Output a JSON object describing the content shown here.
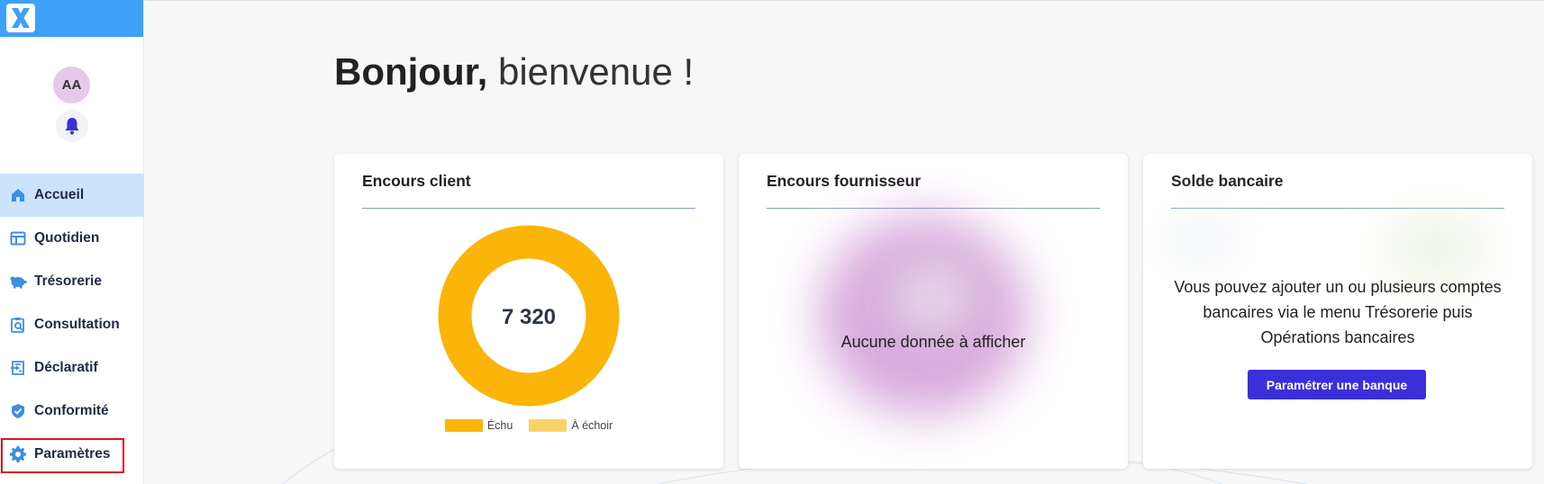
{
  "app": {
    "logo_icon": "x-logo-icon",
    "brand_color": "#3fa0f7"
  },
  "user": {
    "initials": "AA"
  },
  "sidebar": {
    "items": [
      {
        "label": "Accueil",
        "icon": "home-icon",
        "active": true
      },
      {
        "label": "Quotidien",
        "icon": "calendar-table-icon"
      },
      {
        "label": "Trésorerie",
        "icon": "piggy-bank-icon"
      },
      {
        "label": "Consultation",
        "icon": "clipboard-search-icon"
      },
      {
        "label": "Déclaratif",
        "icon": "document-send-icon"
      },
      {
        "label": "Conformité",
        "icon": "shield-check-icon"
      },
      {
        "label": "Paramètres",
        "icon": "gear-icon",
        "highlighted": true
      }
    ]
  },
  "main": {
    "greeting_bold": "Bonjour,",
    "greeting_rest": " bienvenue !"
  },
  "cards": {
    "client": {
      "title": "Encours client",
      "total": "7 320",
      "legend": [
        {
          "label": "Échu",
          "color": "#fbb409"
        },
        {
          "label": "À échoir",
          "color": "#f9d36a"
        }
      ]
    },
    "supplier": {
      "title": "Encours fournisseur",
      "empty_message": "Aucune donnée à afficher"
    },
    "bank": {
      "title": "Solde bancaire",
      "message": "Vous pouvez ajouter un ou plusieurs comptes bancaires via le menu Trésorerie puis Opérations bancaires",
      "button_label": "Paramétrer une banque",
      "button_color": "#3b2fd9"
    }
  }
}
